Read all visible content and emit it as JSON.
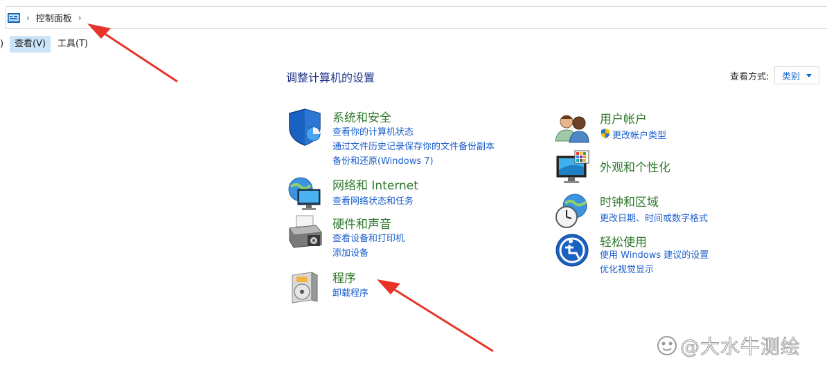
{
  "address_bar": {
    "breadcrumb": "控制面板"
  },
  "menubar": {
    "fragment": ")",
    "view": "查看(V)",
    "tools": "工具(T)"
  },
  "page_title": "调整计算机的设置",
  "view_by": {
    "label": "查看方式:",
    "value": "类别"
  },
  "categories": {
    "system": {
      "title": "系统和安全",
      "links": [
        "查看你的计算机状态",
        "通过文件历史记录保存你的文件备份副本",
        "备份和还原(Windows 7)"
      ]
    },
    "network": {
      "title": "网络和 Internet",
      "links": [
        "查看网络状态和任务"
      ]
    },
    "hardware": {
      "title": "硬件和声音",
      "links": [
        "查看设备和打印机",
        "添加设备"
      ]
    },
    "programs": {
      "title": "程序",
      "links": [
        "卸载程序"
      ]
    },
    "user_accounts": {
      "title": "用户帐户",
      "links": [
        "更改帐户类型"
      ]
    },
    "appearance": {
      "title": "外观和个性化",
      "links": []
    },
    "clock": {
      "title": "时钟和区域",
      "links": [
        "更改日期、时间或数字格式"
      ]
    },
    "ease": {
      "title": "轻松使用",
      "links": [
        "使用 Windows 建议的设置",
        "优化视觉显示"
      ]
    }
  },
  "watermark": "@大水牛测绘",
  "colors": {
    "title_green": "#2f7a2c",
    "link_blue": "#1b5fcc",
    "heading_blue": "#1e3287",
    "arrow_red": "#e8332a"
  }
}
